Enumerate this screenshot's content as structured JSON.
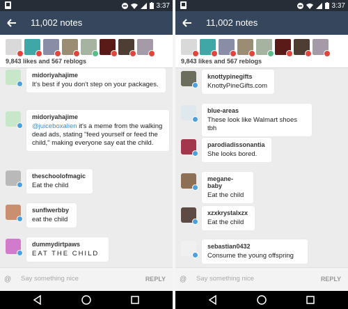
{
  "status_bar": {
    "time": "3:37"
  },
  "header": {
    "title": "11,002 notes"
  },
  "summary": {
    "counts": "9,843 likes and 567 reblogs"
  },
  "likers": [
    {
      "color": "#d9d9d9",
      "badge": "like"
    },
    {
      "color": "#3fa7a6",
      "badge": "like"
    },
    {
      "color": "#8a8da6",
      "badge": "like"
    },
    {
      "color": "#9b8c74",
      "badge": "like"
    },
    {
      "color": "#a7b3a1",
      "badge": "reblog"
    },
    {
      "color": "#5a1a17",
      "badge": "like"
    },
    {
      "color": "#4e3d33",
      "badge": "like"
    },
    {
      "color": "#a59ba8",
      "badge": "like"
    }
  ],
  "left_notes": [
    {
      "username": "midoriyahajime",
      "text": "It's best if you don't step on your packages.",
      "avatar_color": "#c8e6c9"
    },
    {
      "username": "midoriyahajime",
      "mention": "@juiceboxalien",
      "text": " it's a meme from the walking dead ads, stating \"feed yourself or feed the child,\" making everyone say eat the child.",
      "avatar_color": "#c8e6c9"
    },
    {
      "username": "theschoolofmagic",
      "text": "Eat the child",
      "avatar_color": "#b9b9b9"
    },
    {
      "username": "sunflwerbby",
      "text": "eat the child",
      "avatar_color": "#c98f6e"
    },
    {
      "username": "dummydirtpaws",
      "text": "EAT THE CHILD",
      "avatar_color": "#d07bcc"
    }
  ],
  "right_notes": [
    {
      "username": "knottypinegifts",
      "text": "KnottyPineGifts.com",
      "avatar_color": "#6b6e5c"
    },
    {
      "username": "blue-areas",
      "text": "These look like Walmart shoes tbh",
      "avatar_color": "#dfe8ec"
    },
    {
      "username": "parodiadissonantia",
      "text": "She looks bored.",
      "avatar_color": "#a2364d"
    },
    {
      "username": "megane-baby",
      "text": "Eat the child",
      "avatar_color": "#8c6f54"
    },
    {
      "username": "xzxkrystalxzx",
      "text": "Eat the child",
      "avatar_color": "#5d4a44"
    },
    {
      "username": "sebastian0432",
      "text": "Consume the young offspring",
      "avatar_color": "#f0f0f0"
    }
  ],
  "reply": {
    "placeholder": "Say something nice",
    "button": "REPLY",
    "at": "@"
  },
  "icons": {
    "back": "arrow-back-icon",
    "nav_back": "triangle-back-icon",
    "nav_home": "circle-home-icon",
    "nav_recents": "square-recents-icon"
  }
}
